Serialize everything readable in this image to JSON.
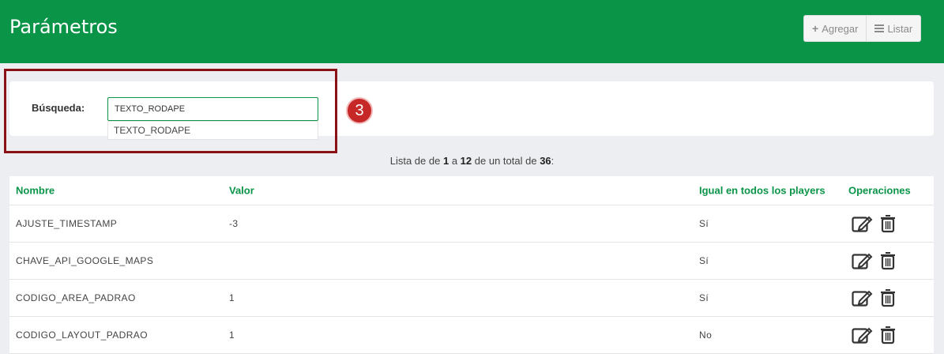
{
  "header": {
    "title": "Parámetros",
    "add_label": "Agregar",
    "list_label": "Listar"
  },
  "search": {
    "label": "Búsqueda:",
    "value": "TEXTO_RODAPE",
    "suggestion": "TEXTO_RODAPE"
  },
  "step_badge": "3",
  "summary": {
    "prefix": "Lista de de",
    "from": "1",
    "a": "a",
    "to": "12",
    "middle": "de un total de",
    "total": "36",
    "suffix": ":"
  },
  "table": {
    "columns": [
      "Nombre",
      "Valor",
      "Igual en todos los players",
      "Operaciones"
    ],
    "rows": [
      {
        "nombre": "AJUSTE_TIMESTAMP",
        "valor": "-3",
        "igual": "Sí"
      },
      {
        "nombre": "CHAVE_API_GOOGLE_MAPS",
        "valor": "",
        "igual": "Sí"
      },
      {
        "nombre": "CODIGO_AREA_PADRAO",
        "valor": "1",
        "igual": "Sí"
      },
      {
        "nombre": "CODIGO_LAYOUT_PADRAO",
        "valor": "1",
        "igual": "No"
      }
    ]
  },
  "icons": {
    "edit": "edit-icon",
    "delete": "trash-icon",
    "add": "plus-icon",
    "list": "list-icon"
  },
  "colors": {
    "brand_green": "#0a9447",
    "highlight_red": "#8b1214",
    "badge_red": "#c62828"
  }
}
